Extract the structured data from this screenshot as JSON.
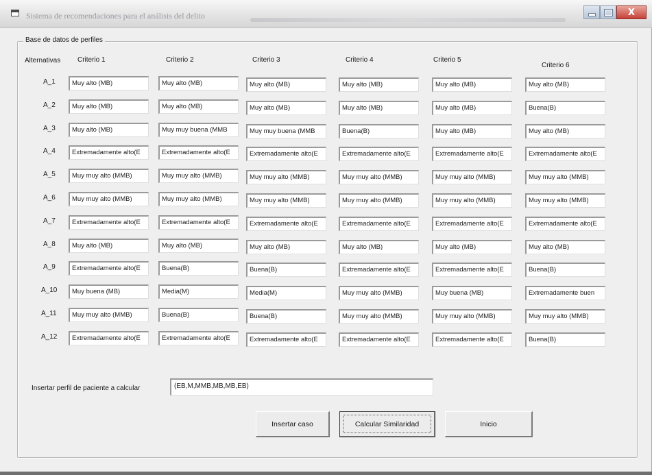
{
  "window": {
    "title": "Sistema de recomendaciones para el análisis del delito",
    "close_label": "X"
  },
  "group": {
    "legend": "Base de datos de perfiles"
  },
  "table": {
    "row_header": "Alternativas",
    "columns": [
      "Criterio 1",
      "Criterio 2",
      "Criterio 3",
      "Criterio 4",
      "Criterio 5",
      "Criterio 6"
    ],
    "rows": [
      {
        "label": "A_1",
        "cells": [
          "Muy alto (MB)",
          "Muy alto (MB)",
          "Muy alto (MB)",
          "Muy alto (MB)",
          "Muy alto (MB)",
          "Muy alto (MB)"
        ]
      },
      {
        "label": "A_2",
        "cells": [
          "Muy alto (MB)",
          "Muy alto (MB)",
          "Muy alto (MB)",
          "Muy alto (MB)",
          "Muy alto (MB)",
          "Buena(B)"
        ]
      },
      {
        "label": "A_3",
        "cells": [
          "Muy alto (MB)",
          "Muy muy buena (MMB",
          "Muy muy buena (MMB",
          "Buena(B)",
          "Muy alto (MB)",
          "Muy alto (MB)"
        ]
      },
      {
        "label": "A_4",
        "cells": [
          "Extremadamente alto(E",
          "Extremadamente alto(E",
          "Extremadamente alto(E",
          "Extremadamente alto(E",
          "Extremadamente alto(E",
          "Extremadamente alto(E"
        ]
      },
      {
        "label": "A_5",
        "cells": [
          "Muy muy alto (MMB)",
          "Muy muy alto (MMB)",
          "Muy muy alto (MMB)",
          "Muy muy alto (MMB)",
          "Muy muy alto (MMB)",
          "Muy muy alto (MMB)"
        ]
      },
      {
        "label": "A_6",
        "cells": [
          "Muy muy alto (MMB)",
          "Muy muy alto (MMB)",
          "Muy muy alto (MMB)",
          "Muy muy alto (MMB)",
          "Muy muy alto (MMB)",
          "Muy muy alto (MMB)"
        ]
      },
      {
        "label": "A_7",
        "cells": [
          "Extremadamente alto(E",
          "Extremadamente alto(E",
          "Extremadamente alto(E",
          "Extremadamente alto(E",
          "Extremadamente alto(E",
          "Extremadamente alto(E"
        ]
      },
      {
        "label": "A_8",
        "cells": [
          "Muy alto (MB)",
          "Muy alto (MB)",
          "Muy alto (MB)",
          "Muy alto (MB)",
          "Muy alto (MB)",
          "Muy alto (MB)"
        ]
      },
      {
        "label": "A_9",
        "cells": [
          "Extremadamente alto(E",
          "Buena(B)",
          "Buena(B)",
          "Extremadamente alto(E",
          "Extremadamente alto(E",
          "Buena(B)"
        ]
      },
      {
        "label": "A_10",
        "cells": [
          "Muy buena (MB)",
          "Media(M)",
          "Media(M)",
          "Muy muy alto (MMB)",
          "Muy buena (MB)",
          "Extremadamente buen"
        ]
      },
      {
        "label": "A_11",
        "cells": [
          "Muy muy alto (MMB)",
          "Buena(B)",
          "Buena(B)",
          "Muy muy alto (MMB)",
          "Muy muy alto (MMB)",
          "Muy muy alto (MMB)"
        ]
      },
      {
        "label": "A_12",
        "cells": [
          "Extremadamente alto(E",
          "Extremadamente alto(E",
          "Extremadamente alto(E",
          "Extremadamente alto(E",
          "Extremadamente alto(E",
          "Buena(B)"
        ]
      }
    ]
  },
  "patient": {
    "label": "Insertar perfil de paciente a calcular",
    "value": "(EB,M,MMB,MB,MB,EB)"
  },
  "buttons": {
    "insert": "Insertar caso",
    "calculate": "Calcular Similaridad",
    "home": "Inicio"
  }
}
